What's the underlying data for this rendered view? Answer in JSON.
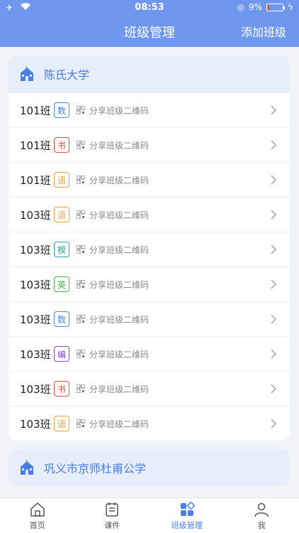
{
  "status": {
    "time": "08:53",
    "battery": "9%",
    "battery_level": 0.09
  },
  "header": {
    "title": "班级管理",
    "action": "添加班级"
  },
  "schools": [
    {
      "name": "陈氏大学",
      "share_label": "分享班级二维码",
      "classes": [
        {
          "name": "101班",
          "subject": "数",
          "color": "#4a86e8"
        },
        {
          "name": "101班",
          "subject": "书",
          "color": "#e0533b"
        },
        {
          "name": "101班",
          "subject": "语",
          "color": "#f0a32d"
        },
        {
          "name": "103班",
          "subject": "语",
          "color": "#f0a32d"
        },
        {
          "name": "103班",
          "subject": "模",
          "color": "#27a5a8"
        },
        {
          "name": "103班",
          "subject": "英",
          "color": "#45b34a"
        },
        {
          "name": "103班",
          "subject": "数",
          "color": "#4a86e8"
        },
        {
          "name": "103班",
          "subject": "编",
          "color": "#7d4bd9"
        },
        {
          "name": "103班",
          "subject": "书",
          "color": "#e0533b"
        },
        {
          "name": "103班",
          "subject": "语",
          "color": "#f0a32d"
        }
      ]
    },
    {
      "name": "巩义市京师杜甫公学"
    }
  ],
  "tabs": [
    {
      "label": "首页",
      "icon": "home-icon"
    },
    {
      "label": "课件",
      "icon": "courseware-icon"
    },
    {
      "label": "班级管理",
      "icon": "class-management-icon",
      "active": true
    },
    {
      "label": "我",
      "icon": "profile-icon"
    }
  ]
}
